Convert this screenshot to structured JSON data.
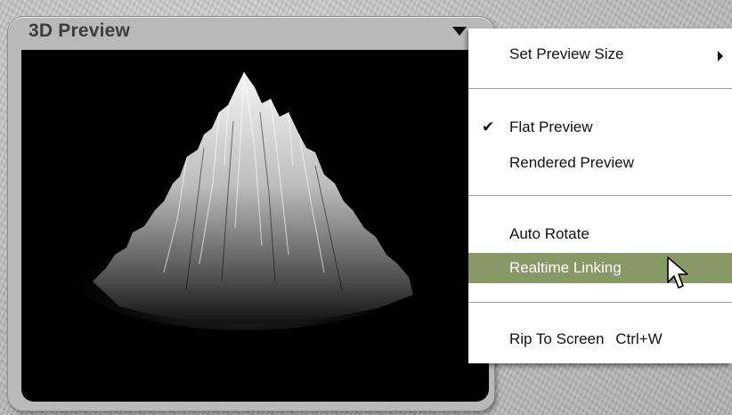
{
  "panel": {
    "title": "3D Preview"
  },
  "menu": {
    "items": [
      {
        "label": "Set Preview Size",
        "has_submenu": true
      },
      {
        "label": "Flat Preview",
        "checked": true
      },
      {
        "label": "Rendered Preview"
      },
      {
        "label": "Auto Rotate"
      },
      {
        "label": "Realtime Linking",
        "highlighted": true
      },
      {
        "label": "Rip To Screen",
        "shortcut": "Ctrl+W"
      }
    ]
  },
  "colors": {
    "highlight": "#879965",
    "panel_bg": "#b9b9b9"
  },
  "icons": [
    "panel-menu-arrow-icon",
    "check-icon",
    "submenu-arrow-icon",
    "mouse-cursor-icon"
  ]
}
